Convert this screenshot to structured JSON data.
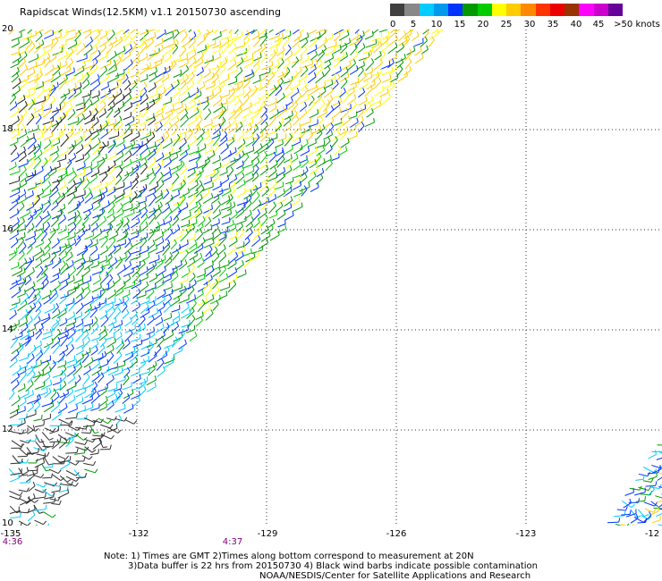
{
  "title": "Rapidscat Winds(12.5KM) v1.1 20150730 ascending",
  "legend": {
    "unit_label": ">50 knots",
    "ticks": [
      "0",
      "5",
      "10",
      "15",
      "20",
      "25",
      "30",
      "35",
      "40",
      "45"
    ],
    "colors": [
      "#404040",
      "#888888",
      "#00ccff",
      "#0099ee",
      "#0033ff",
      "#009900",
      "#00cc00",
      "#ffff00",
      "#ffcc00",
      "#ff8800",
      "#ff3300",
      "#ee0000",
      "#993300",
      "#ff00ff",
      "#cc00cc",
      "#660099"
    ]
  },
  "map": {
    "latitude_labels": [
      "20",
      "18",
      "16",
      "14",
      "12",
      "10"
    ],
    "longitude_labels": [
      "-135",
      "-132",
      "-129",
      "-126",
      "-123",
      "-12"
    ],
    "time_labels": [
      "4:36",
      "4:37"
    ]
  },
  "notes": {
    "line1": "Note: 1) Times are GMT 2)Times along bottom correspond to measurement at 20N",
    "line2": "3)Data buffer is 22 hrs from 20150730 4) Black wind barbs indicate possible contamination",
    "line3": "NOAA/NESDIS/Center for Satellite Applications and Research"
  }
}
